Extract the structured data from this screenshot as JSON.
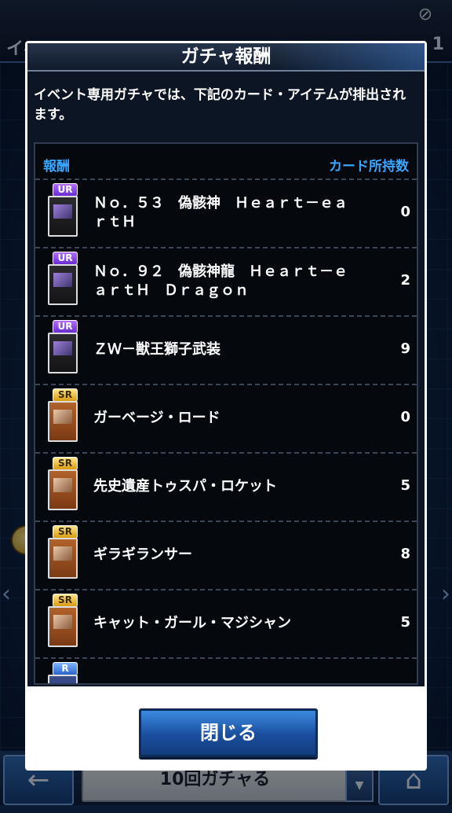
{
  "background": {
    "top_title": "イベ",
    "top_number": "1",
    "bottom_field": "10回ガチャる"
  },
  "modal": {
    "title": "ガチャ報酬",
    "description": "イベント専用ガチャでは、下記のカード・アイテムが排出されます。",
    "column_reward": "報酬",
    "column_owned": "カード所持数",
    "close_label": "閉じる",
    "items": [
      {
        "rarity": "UR",
        "name": "Ｎｏ．５３　偽骸神　Ｈｅａｒｔ－ｅａｒｔＨ",
        "count": "0"
      },
      {
        "rarity": "UR",
        "name": "Ｎｏ．９２　偽骸神龍　Ｈｅａｒｔ－ｅａｒｔＨ　Ｄｒａｇｏｎ",
        "count": "2"
      },
      {
        "rarity": "UR",
        "name": "ＺＷ－獣王獅子武装",
        "count": "9"
      },
      {
        "rarity": "SR",
        "name": "ガーベージ・ロード",
        "count": "0"
      },
      {
        "rarity": "SR",
        "name": "先史遺産トゥスパ・ロケット",
        "count": "5"
      },
      {
        "rarity": "SR",
        "name": "ギラギランサー",
        "count": "8"
      },
      {
        "rarity": "SR",
        "name": "キャット・ガール・マジシャン",
        "count": "5"
      },
      {
        "rarity": "R",
        "name": "",
        "count": ""
      }
    ]
  },
  "colors": {
    "accent_blue": "#3aa6ff",
    "ur_purple": "#8a4cf0",
    "sr_gold": "#e5b22c",
    "r_blue": "#3a7ae0"
  }
}
